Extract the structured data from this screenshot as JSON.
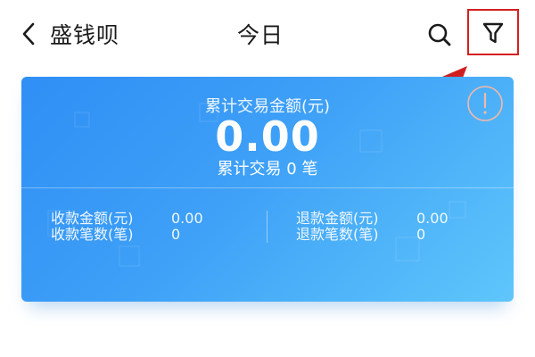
{
  "header": {
    "back_icon": "chevron-left-icon",
    "app_title": "盛钱呗",
    "page_title": "今日",
    "search_icon": "search-icon",
    "filter_icon": "filter-icon"
  },
  "annotation": {
    "highlight_color": "#d42020"
  },
  "summary": {
    "total_label": "累计交易金额(元)",
    "total_amount": "0.00",
    "total_count": "累计交易 0 笔",
    "info_icon": "info-icon",
    "receive": {
      "amount_label": "收款金额(元)",
      "amount_value": "0.00",
      "count_label": "收款笔数(笔)",
      "count_value": "0"
    },
    "refund": {
      "amount_label": "退款金额(元)",
      "amount_value": "0.00",
      "count_label": "退款笔数(笔)",
      "count_value": "0"
    }
  },
  "colors": {
    "card_gradient_start": "#2f8ff5",
    "card_gradient_end": "#5fc6fb",
    "annotation_red": "#d42020"
  }
}
